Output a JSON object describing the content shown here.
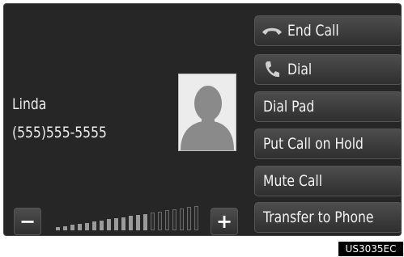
{
  "caller": {
    "name": "Linda",
    "number": "(555)555-5555",
    "avatar_icon": "person-silhouette-icon"
  },
  "buttons": {
    "end_call": {
      "label": "End Call",
      "icon": "hang-up-icon"
    },
    "dial": {
      "label": "Dial",
      "icon": "phone-handset-icon"
    },
    "dial_pad": {
      "label": "Dial Pad"
    },
    "put_call_on_hold": {
      "label": "Put Call on Hold"
    },
    "mute_call": {
      "label": "Mute Call"
    },
    "transfer_to_phone": {
      "label": "Transfer to Phone"
    }
  },
  "volume": {
    "minus_label": "−",
    "plus_label": "+",
    "level": 13,
    "max_level": 20
  },
  "figure_code": "US3035EC",
  "colors": {
    "screen_bg": "#262626",
    "button_bg": "#3f3f3f",
    "text": "#f2f2f2",
    "volume_bar_active": "#9a9a9a"
  }
}
